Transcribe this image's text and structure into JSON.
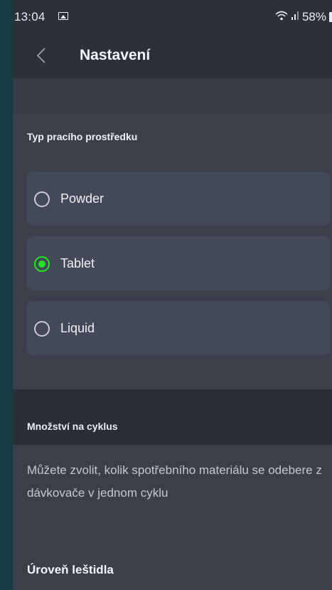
{
  "status_bar": {
    "time": "13:04",
    "battery": "58%",
    "icons": [
      "image-icon",
      "wifi-icon",
      "signal-icon",
      "battery-icon"
    ]
  },
  "header": {
    "title": "Nastavení",
    "back_icon": "chevron-left-icon"
  },
  "detergent_section": {
    "label": "Typ pracího prostředku",
    "options": [
      {
        "label": "Powder",
        "selected": false
      },
      {
        "label": "Tablet",
        "selected": true
      },
      {
        "label": "Liquid",
        "selected": false
      }
    ]
  },
  "amount_section": {
    "label": "Množství na cyklus",
    "description": "Můžete zvolit, kolik spotřebního materiálu se odebere z dávkovače v jednom cyklu"
  },
  "rinse_section": {
    "label": "Úroveň leštidla"
  },
  "colors": {
    "accent": "#1ee61f",
    "background": "#3a3f49",
    "card": "#434957",
    "bar": "#2c3038"
  }
}
